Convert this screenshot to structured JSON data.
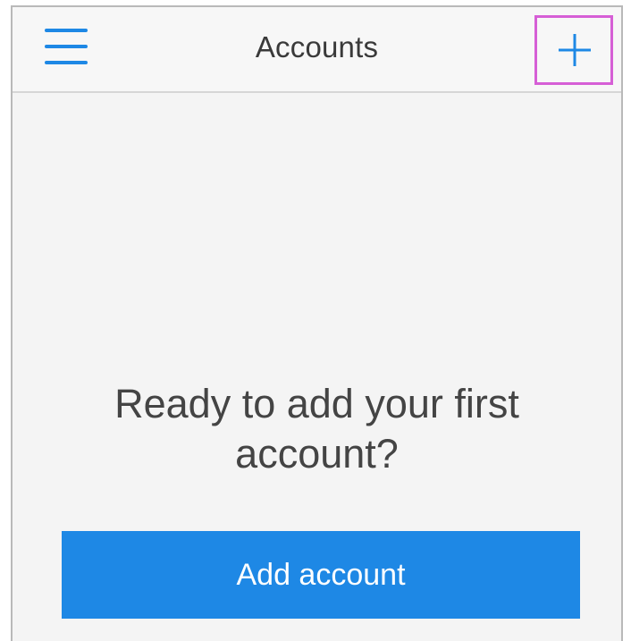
{
  "header": {
    "title": "Accounts",
    "menu_icon": "hamburger-menu-icon",
    "add_icon": "plus-icon",
    "highlight_color": "#d65fd6"
  },
  "main": {
    "prompt_line1": "Ready to add your first",
    "prompt_line2": "account?",
    "button_label": "Add account"
  },
  "colors": {
    "accent": "#1e88e5",
    "background": "#f4f4f4",
    "text": "#444444"
  }
}
